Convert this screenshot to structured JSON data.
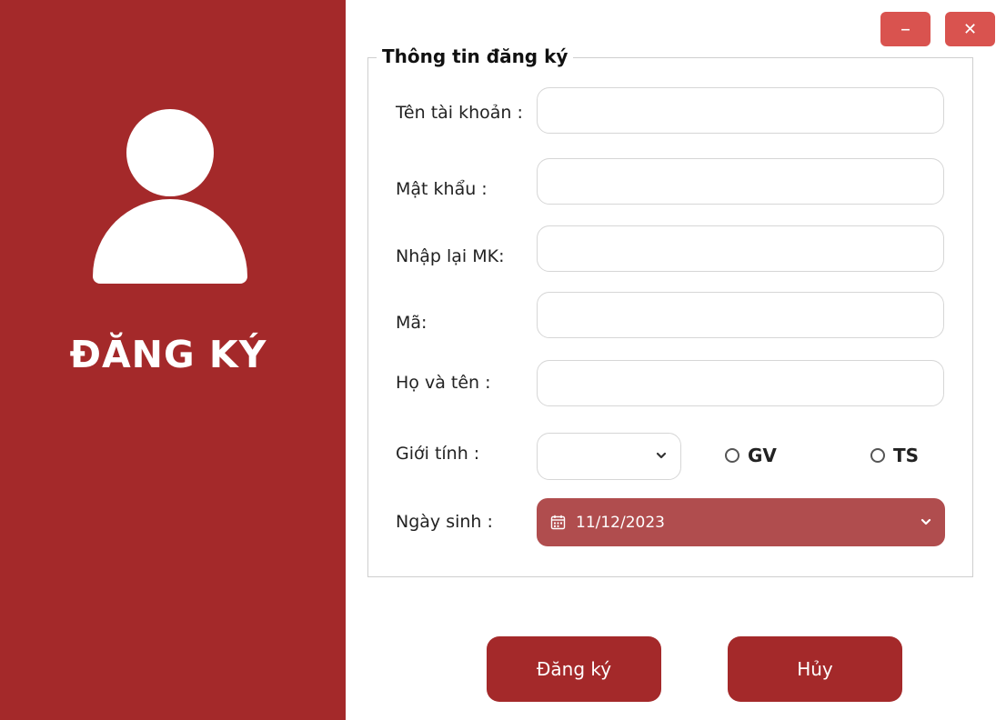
{
  "sidebar": {
    "title": "ĐĂNG KÝ",
    "icon": "user-icon",
    "background": "#a4292a"
  },
  "window_controls": {
    "minimize_icon": "minimize-icon",
    "minimize_glyph": "–",
    "close_icon": "close-icon",
    "close_glyph": "✕",
    "color": "#d9534f"
  },
  "form": {
    "legend": "Thông tin đăng ký",
    "fields": {
      "username": {
        "label": "Tên tài khoản :",
        "value": ""
      },
      "password": {
        "label": "Mật khẩu :",
        "value": ""
      },
      "confirm_password": {
        "label": "Nhập lại MK:",
        "value": ""
      },
      "code": {
        "label": "Mã:",
        "value": ""
      },
      "full_name": {
        "label": "Họ và tên :",
        "value": ""
      }
    },
    "gender": {
      "label": "Giới tính :",
      "selected": "",
      "icon": "chevron-down-icon"
    },
    "role_options": {
      "gv": "GV",
      "ts": "TS"
    },
    "birthdate": {
      "label": "Ngày sinh :",
      "value": "11/12/2023",
      "icon": "calendar-icon",
      "color": "#b04d4e"
    }
  },
  "actions": {
    "register_label": "Đăng ký",
    "cancel_label": "Hủy"
  }
}
